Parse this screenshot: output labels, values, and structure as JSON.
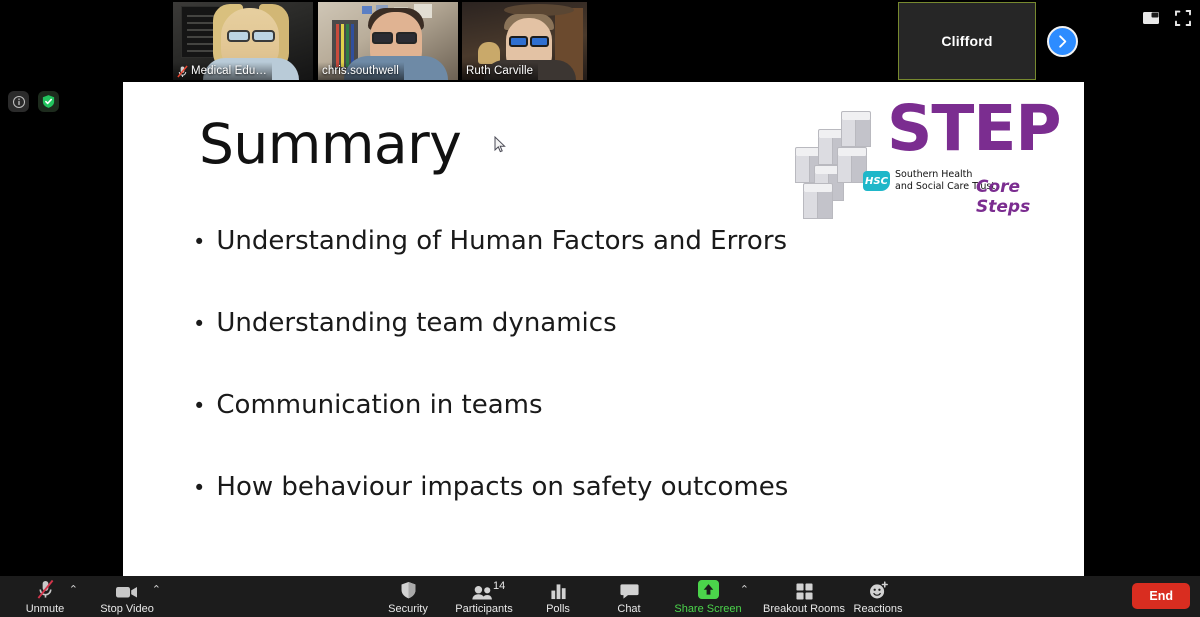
{
  "meeting": {
    "participant_tiles": [
      {
        "name": "Medical Edu…",
        "muted": true,
        "video_on": true,
        "active_speaker": false,
        "scene": "woman-glasses-poster"
      },
      {
        "name": "chris.southwell",
        "muted": false,
        "video_on": true,
        "active_speaker": false,
        "scene": "man-glasses-shelf"
      },
      {
        "name": "Ruth Carville",
        "muted": false,
        "video_on": true,
        "active_speaker": false,
        "scene": "woman-glasses-fan"
      },
      {
        "name": "Clifford",
        "muted": false,
        "video_on": false,
        "active_speaker": true,
        "scene": "name-only"
      }
    ],
    "next_page_arrow": "›",
    "window_controls": [
      {
        "name": "picture-in-picture-icon",
        "label": "Minimize"
      },
      {
        "name": "fullscreen-icon",
        "label": "Enter Full Screen"
      }
    ],
    "left_indicators": [
      {
        "name": "meeting-info-icon",
        "label": "i"
      },
      {
        "name": "encryption-shield-icon",
        "label": "✓"
      }
    ]
  },
  "slide": {
    "title": "Summary",
    "bullet_marker": "•",
    "bullets": [
      "Understanding of Human Factors and Errors",
      "Understanding team dynamics",
      "Communication in teams",
      "How behaviour impacts on safety outcomes"
    ],
    "logo": {
      "wordmark": "STEP",
      "hsc": "HSC",
      "trust_line1": "Southern Health",
      "trust_line2": "and Social Care Trust",
      "tagline": "Core Steps",
      "purple": "#7b2d90",
      "teal": "#1fb7c9"
    }
  },
  "toolbar": {
    "mic": {
      "label": "Unmute",
      "state": "muted"
    },
    "video": {
      "label": "Stop Video",
      "state": "on"
    },
    "security": {
      "label": "Security"
    },
    "participants": {
      "label": "Participants",
      "count": "14"
    },
    "polls": {
      "label": "Polls"
    },
    "chat": {
      "label": "Chat"
    },
    "share_screen": {
      "label": "Share Screen",
      "active": true,
      "accent": "#4bd44b"
    },
    "breakout_rooms": {
      "label": "Breakout Rooms"
    },
    "reactions": {
      "label": "Reactions"
    },
    "end": {
      "label": "End",
      "color": "#d92d20"
    },
    "chevron": "⌃"
  }
}
